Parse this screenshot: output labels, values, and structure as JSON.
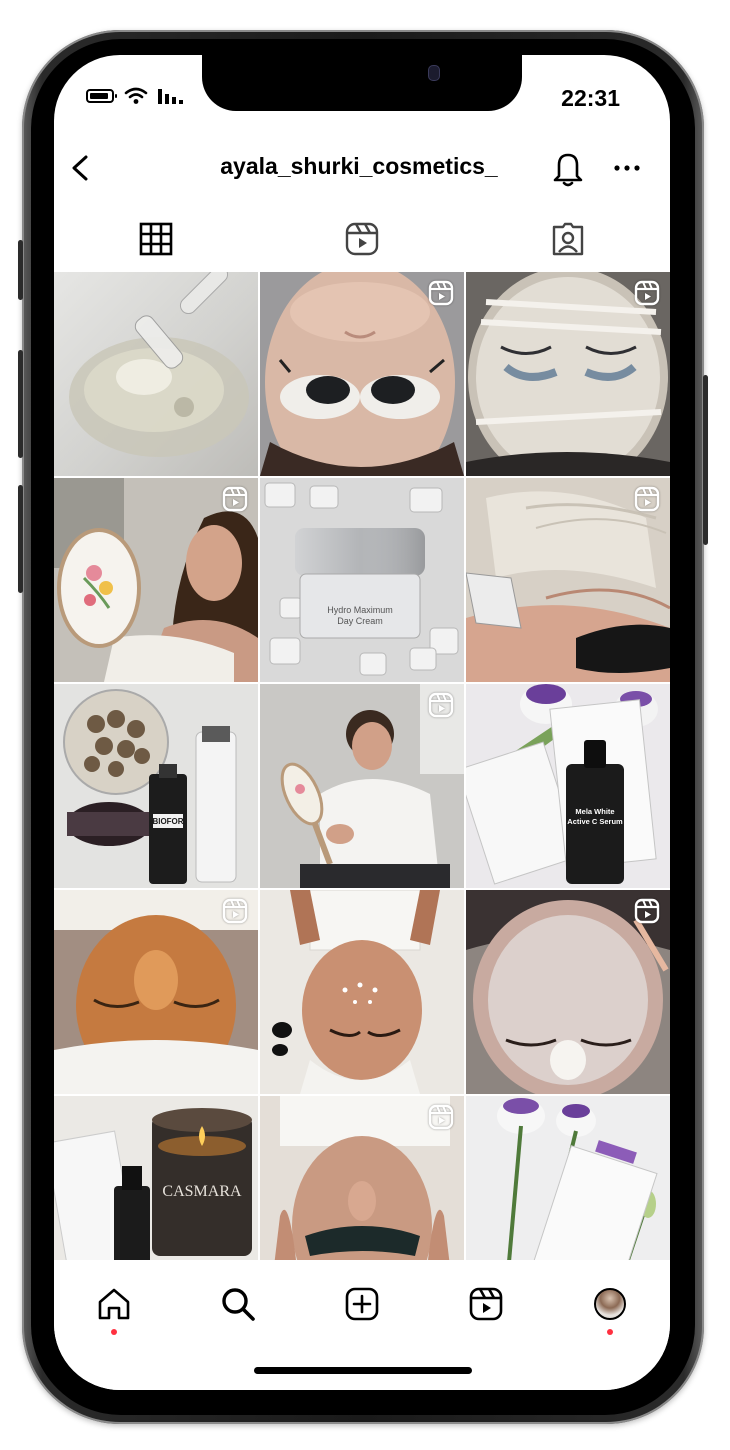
{
  "status_bar": {
    "time": "22:31"
  },
  "header": {
    "username": "ayala_shurki_cosmetics_"
  },
  "tabs": [
    {
      "name": "grid",
      "icon": "grid-icon",
      "active": true
    },
    {
      "name": "reels",
      "icon": "reels-icon",
      "active": false
    },
    {
      "name": "tagged",
      "icon": "tagged-icon",
      "active": false
    }
  ],
  "posts": [
    {
      "subject": "serum-dropper",
      "is_reel": false
    },
    {
      "subject": "face-treatment-goggles",
      "is_reel": true
    },
    {
      "subject": "face-mask-gauze",
      "is_reel": true
    },
    {
      "subject": "woman-with-mirror",
      "is_reel": true
    },
    {
      "subject": "cream-jar-ice",
      "is_reel": false,
      "label": "Hydro Maximum Day Cream"
    },
    {
      "subject": "body-treatment-device",
      "is_reel": true
    },
    {
      "subject": "biofor-products",
      "is_reel": false,
      "label": "BIOFOR"
    },
    {
      "subject": "man-with-mirror",
      "is_reel": true
    },
    {
      "subject": "mela-white-serum",
      "is_reel": false,
      "label": "Mela White Active C Serum"
    },
    {
      "subject": "gold-mask-treatment",
      "is_reel": true
    },
    {
      "subject": "face-stones-treatment",
      "is_reel": false
    },
    {
      "subject": "face-mask-white",
      "is_reel": true
    },
    {
      "subject": "casmara-candle",
      "is_reel": false,
      "label": "CASMARA"
    },
    {
      "subject": "face-goggles-treatment",
      "is_reel": true
    },
    {
      "subject": "flowers-product-box",
      "is_reel": false
    }
  ],
  "bottom_nav": [
    {
      "name": "home",
      "icon": "home-icon",
      "has_dot": true
    },
    {
      "name": "search",
      "icon": "search-icon",
      "has_dot": false
    },
    {
      "name": "create",
      "icon": "plus-square-icon",
      "has_dot": false
    },
    {
      "name": "reels",
      "icon": "reels-icon",
      "has_dot": false
    },
    {
      "name": "profile",
      "icon": "avatar",
      "has_dot": true
    }
  ],
  "colors": {
    "notification_dot": "#ff3040",
    "text": "#000000"
  }
}
